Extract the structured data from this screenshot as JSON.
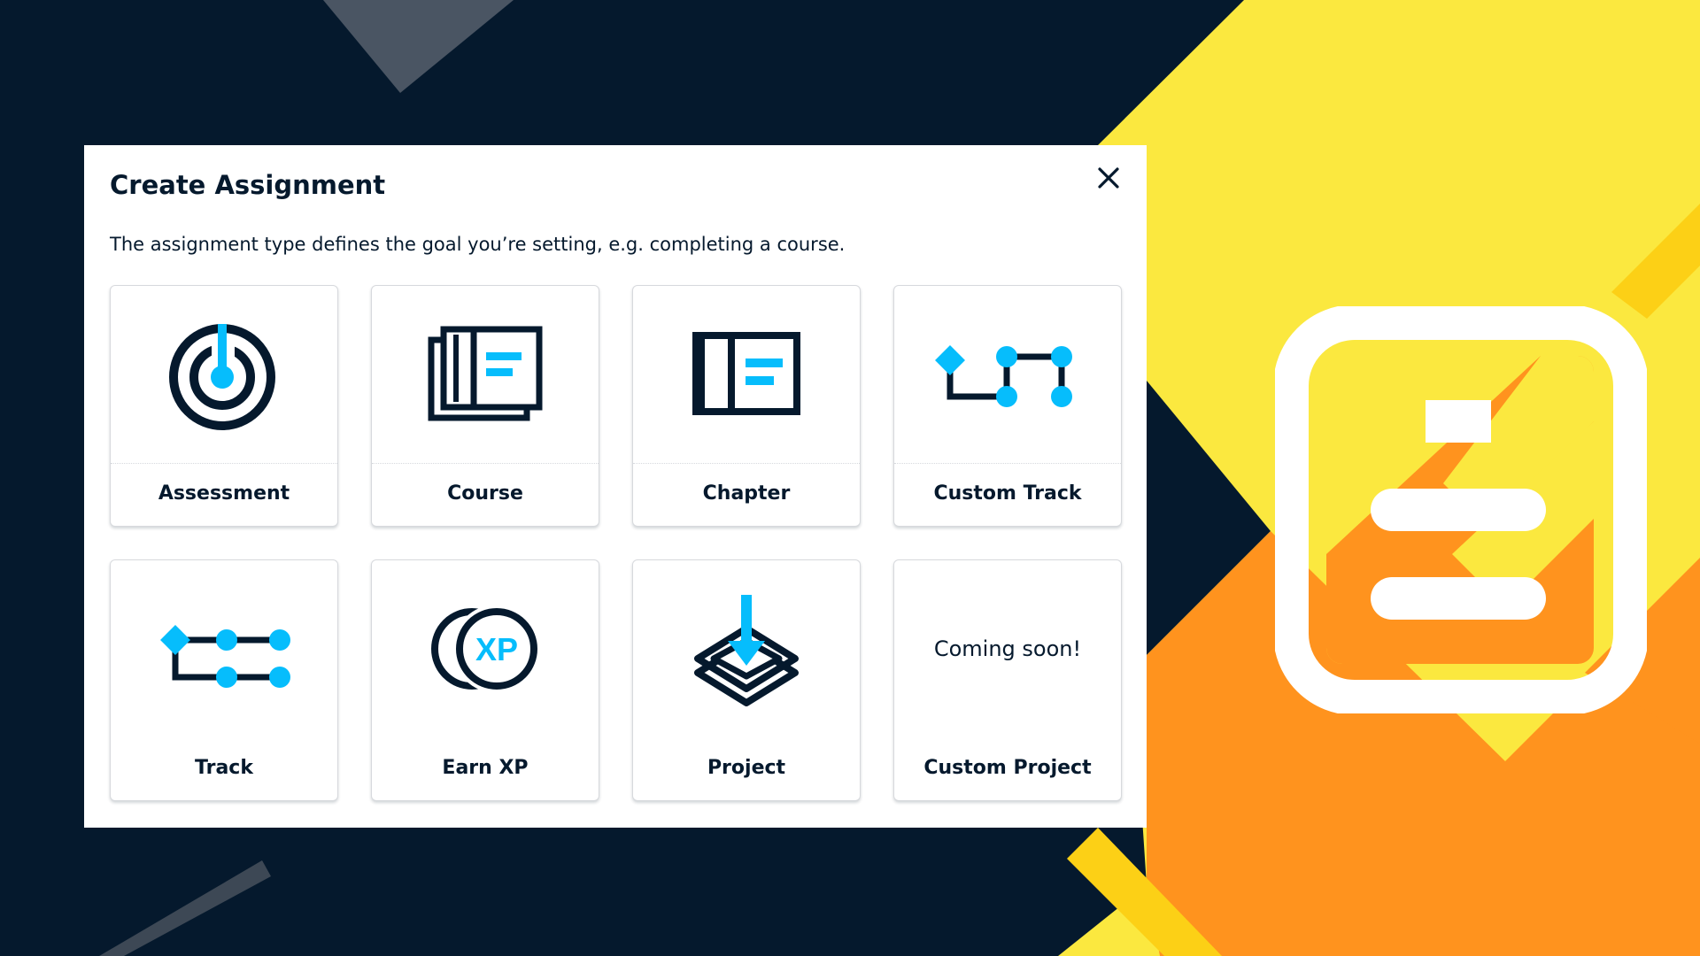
{
  "dialog": {
    "title": "Create Assignment",
    "description": "The assignment type defines the goal you’re setting, e.g. completing a course.",
    "close_icon": "close-icon"
  },
  "cards": [
    {
      "label": "Assessment",
      "icon": "assessment-target-icon"
    },
    {
      "label": "Course",
      "icon": "course-book-icon"
    },
    {
      "label": "Chapter",
      "icon": "chapter-book-icon"
    },
    {
      "label": "Custom Track",
      "icon": "custom-track-path-icon"
    },
    {
      "label": "Track",
      "icon": "track-path-icon"
    },
    {
      "label": "Earn XP",
      "icon": "xp-coins-icon",
      "icon_text": "XP"
    },
    {
      "label": "Project",
      "icon": "project-layers-icon"
    },
    {
      "label": "Custom Project",
      "placeholder": "Coming soon!"
    }
  ],
  "colors": {
    "navy": "#05192d",
    "accent_blue": "#03ef62",
    "icon_blue": "#06bdfc",
    "yellow": "#fbe83f",
    "orange": "#ff931e",
    "white": "#ffffff"
  }
}
